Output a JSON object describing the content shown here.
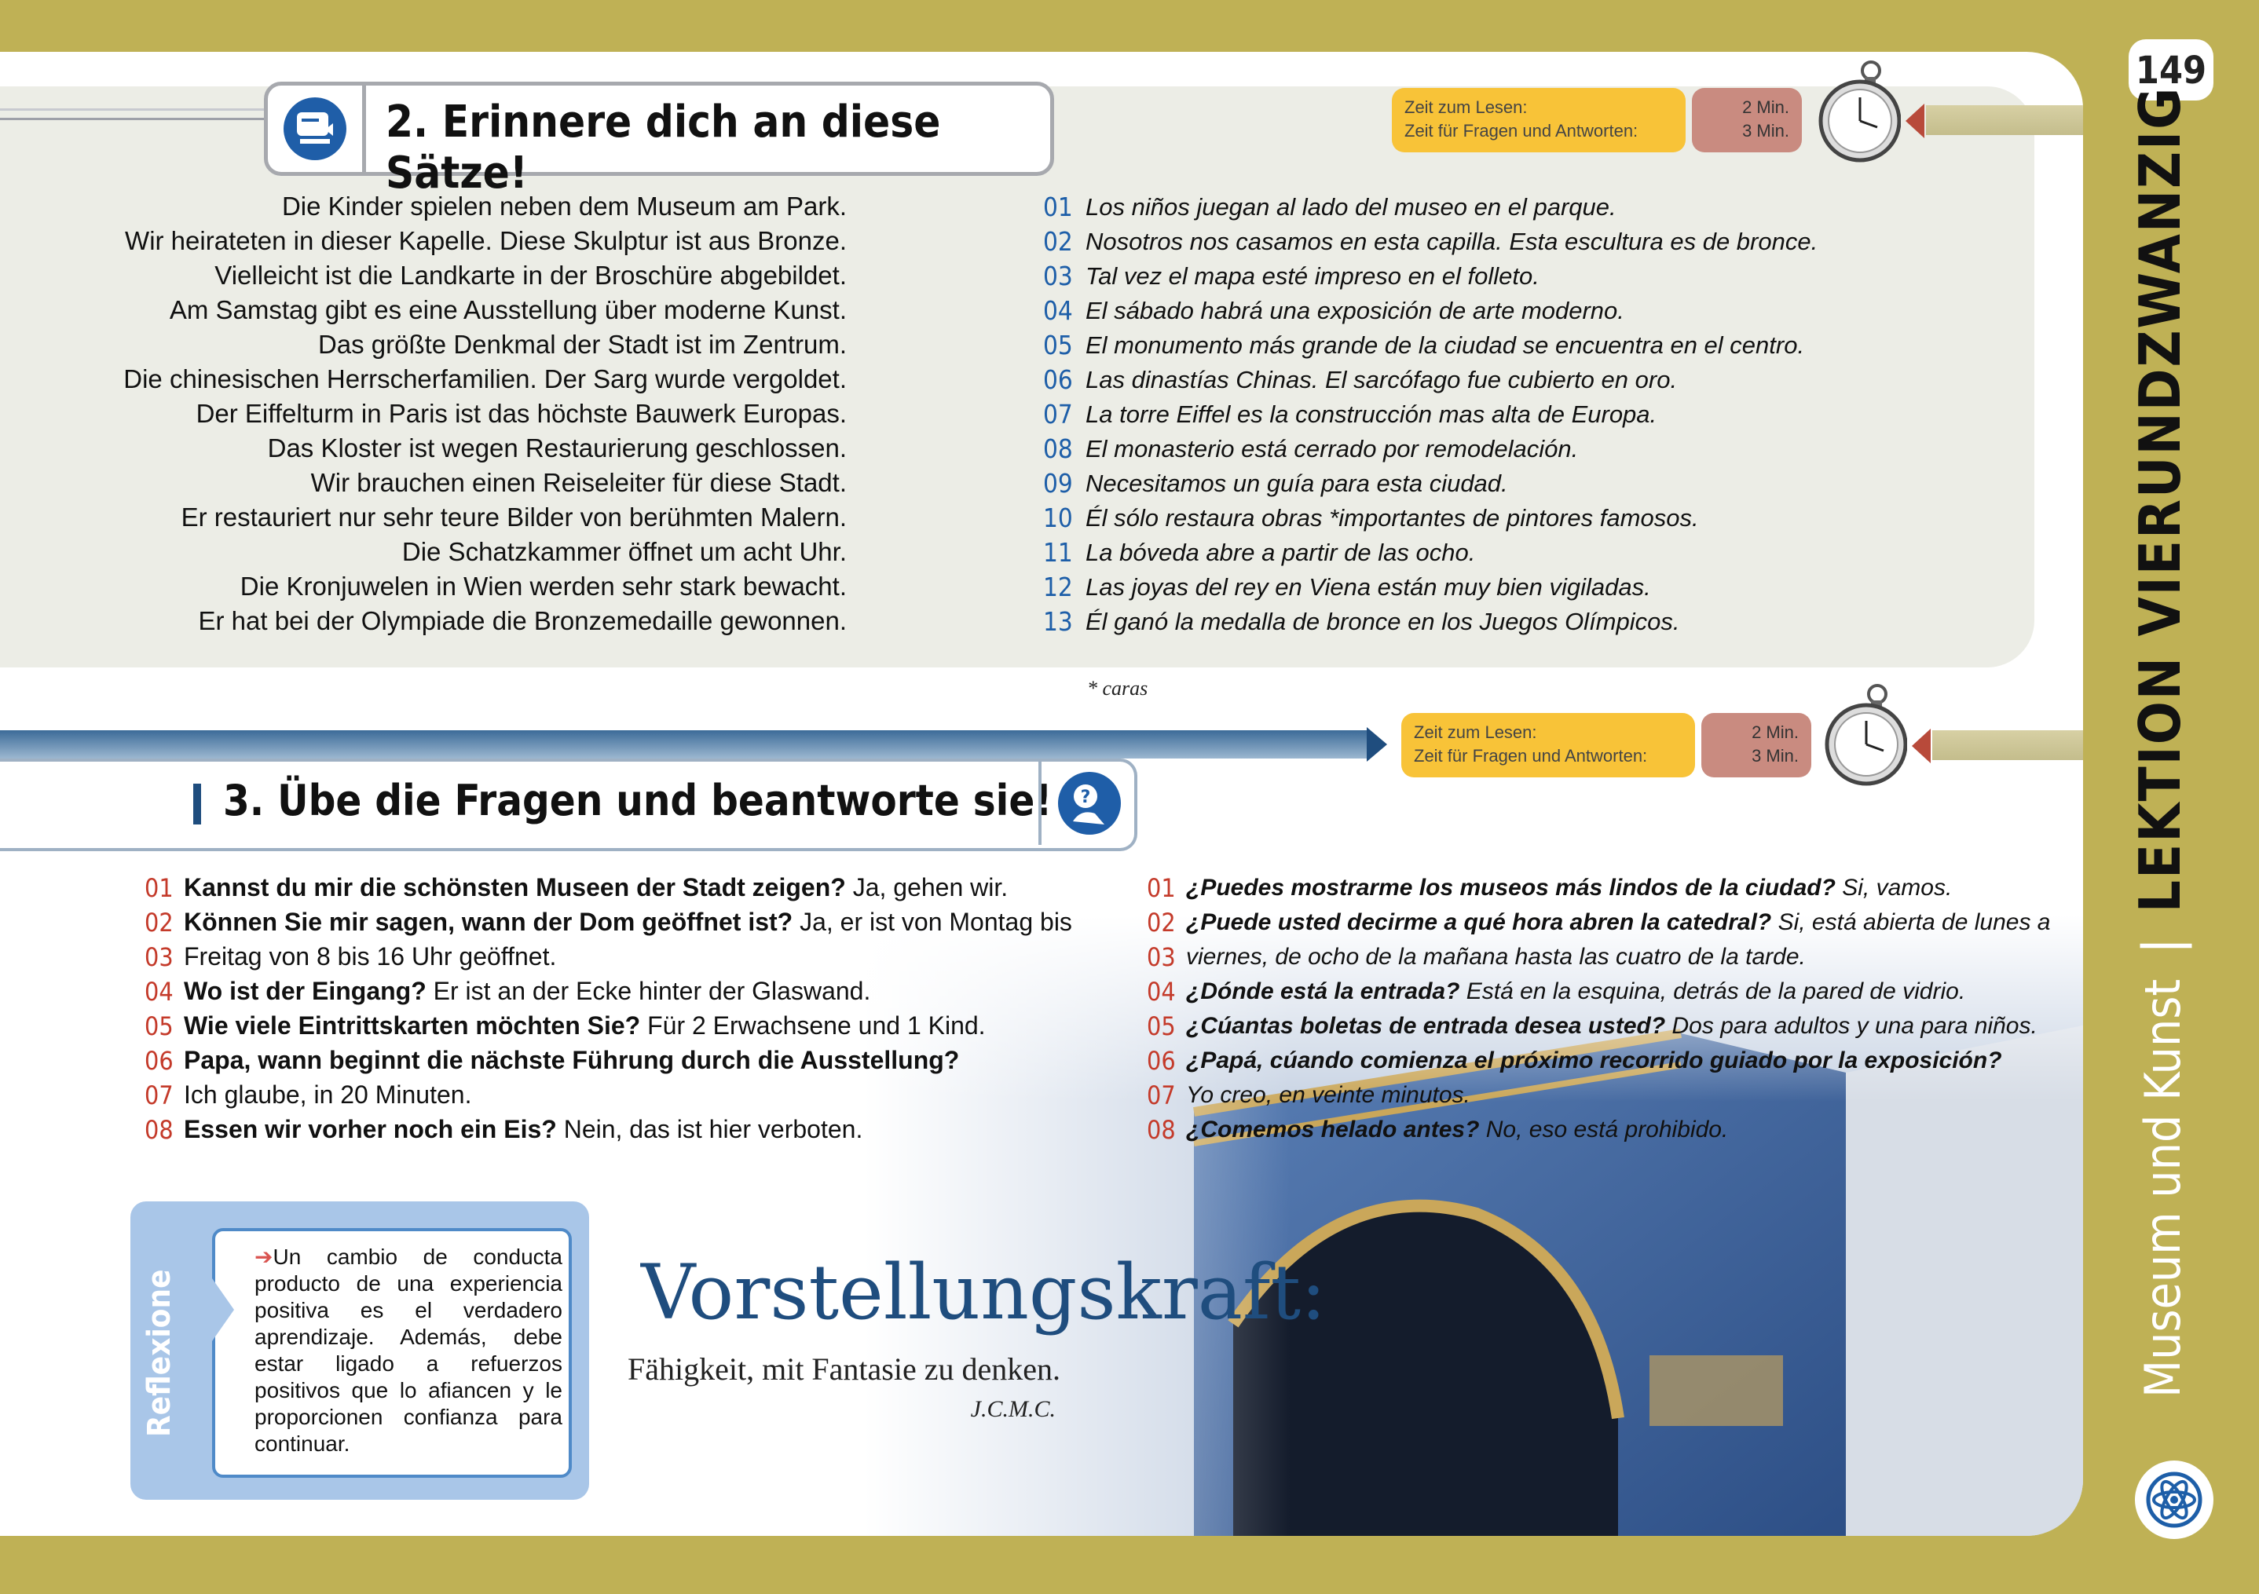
{
  "page_number": "149",
  "sidebar": {
    "lesson_title": "LEKTION VIERUNDZWANZIG",
    "topic": "Museum und Kunst"
  },
  "timer": {
    "read_label": "Zeit zum Lesen:",
    "qa_label": "Zeit für Fragen und Antworten:",
    "read_value": "2 Min.",
    "qa_value": "3 Min."
  },
  "section2": {
    "title": "2. Erinnere dich an diese Sätze!",
    "sentences": [
      {
        "n": "01",
        "de": "Die Kinder spielen neben dem Museum am Park.",
        "es": "Los niños juegan al lado del museo en el parque."
      },
      {
        "n": "02",
        "de": "Wir heirateten in dieser Kapelle. Diese Skulptur ist aus Bronze.",
        "es": "Nosotros nos casamos en esta capilla. Esta escultura es de bronce."
      },
      {
        "n": "03",
        "de": "Vielleicht ist die Landkarte in der Broschüre abgebildet.",
        "es": "Tal vez el mapa esté impreso en el folleto."
      },
      {
        "n": "04",
        "de": "Am Samstag gibt es eine Ausstellung über moderne Kunst.",
        "es": "El sábado habrá una exposición de arte moderno."
      },
      {
        "n": "05",
        "de": "Das größte Denkmal der Stadt ist im Zentrum.",
        "es": "El monumento más grande de la ciudad se encuentra en el centro."
      },
      {
        "n": "06",
        "de": "Die chinesischen Herrscherfamilien. Der Sarg wurde vergoldet.",
        "es": "Las dinastías Chinas. El sarcófago fue cubierto en oro."
      },
      {
        "n": "07",
        "de": "Der Eiffelturm in Paris ist das höchste Bauwerk Europas.",
        "es": "La torre Eiffel es la construcción mas alta de Europa."
      },
      {
        "n": "08",
        "de": "Das Kloster ist wegen Restaurierung geschlossen.",
        "es": "El monasterio está cerrado por remodelación."
      },
      {
        "n": "09",
        "de": "Wir brauchen einen Reiseleiter für diese Stadt.",
        "es": "Necesitamos un guía para esta ciudad."
      },
      {
        "n": "10",
        "de": "Er restauriert nur sehr teure Bilder von berühmten Malern.",
        "es": "Él sólo restaura obras *importantes de pintores famosos."
      },
      {
        "n": "11",
        "de": "Die Schatzkammer öffnet um acht Uhr.",
        "es": "La bóveda abre a partir de las ocho."
      },
      {
        "n": "12",
        "de": "Die Kronjuwelen in Wien werden sehr stark bewacht.",
        "es": "Las joyas del rey en Viena están muy bien vigiladas."
      },
      {
        "n": "13",
        "de": "Er hat bei der Olympiade die Bronzemedaille gewonnen.",
        "es": "Él ganó la medalla de bronce en los Juegos Olímpicos."
      }
    ],
    "footnote": "* caras"
  },
  "section3": {
    "title": "3. Übe die Fragen und beantworte sie!",
    "de_lines": [
      {
        "n": "01",
        "q": "Kannst du mir die schönsten Museen der Stadt zeigen?",
        "a": " Ja, gehen wir."
      },
      {
        "n": "02",
        "q": "Können Sie mir sagen, wann der Dom geöffnet ist?",
        "a": " Ja, er ist von Montag bis"
      },
      {
        "n": "03",
        "q": "",
        "a": "Freitag von 8 bis 16 Uhr geöffnet."
      },
      {
        "n": "04",
        "q": "Wo ist der Eingang?",
        "a": " Er ist an der Ecke hinter der Glaswand."
      },
      {
        "n": "05",
        "q": "Wie viele Eintrittskarten möchten Sie?",
        "a": " Für 2 Erwachsene und 1 Kind."
      },
      {
        "n": "06",
        "q": "Papa, wann beginnt die nächste Führung durch die Ausstellung?",
        "a": ""
      },
      {
        "n": "07",
        "q": "",
        "a": "Ich glaube, in 20 Minuten."
      },
      {
        "n": "08",
        "q": "Essen wir vorher noch ein Eis?",
        "a": " Nein, das ist hier verboten."
      }
    ],
    "es_lines": [
      {
        "n": "01",
        "q": "¿Puedes mostrarme los museos más lindos de la ciudad?",
        "a": " Si, vamos."
      },
      {
        "n": "02",
        "q": "¿Puede usted decirme a qué hora abren la catedral?",
        "a": " Si, está abierta de lunes a"
      },
      {
        "n": "03",
        "q": "",
        "a": "viernes, de ocho de la mañana hasta las cuatro de la tarde."
      },
      {
        "n": "04",
        "q": "¿Dónde está la entrada?",
        "a": " Está en la esquina, detrás de la pared de vidrio."
      },
      {
        "n": "05",
        "q": "¿Cúantas boletas de entrada desea usted?",
        "a": " Dos para adultos y una para niños."
      },
      {
        "n": "06",
        "q": "¿Papá, cúando comienza el próximo recorrido guiado por la exposición?",
        "a": ""
      },
      {
        "n": "07",
        "q": "",
        "a": "Yo creo, en veinte minutos."
      },
      {
        "n": "08",
        "q": "¿Comemos helado antes?",
        "a": " No, eso está prohibido."
      }
    ]
  },
  "reflexion": {
    "label": "Reflexione",
    "text": "Un cambio de conducta producto de una experiencia positiva es el verdadero aprendizaje. Además, debe estar ligado a refuerzos positivos que lo afiancen y le proporcionen confianza para continuar."
  },
  "quote": {
    "word": "Vorstellungskraft:",
    "definition": "Fähigkeit, mit Fantasie zu denken.",
    "author": "J.C.M.C."
  },
  "colors": {
    "accent_blue": "#1f4d7e",
    "number_blue": "#1d5ea8",
    "number_red": "#c43a2a",
    "olive": "#bfb155",
    "timer_yellow": "#f8c338",
    "timer_red": "#c98b80"
  }
}
